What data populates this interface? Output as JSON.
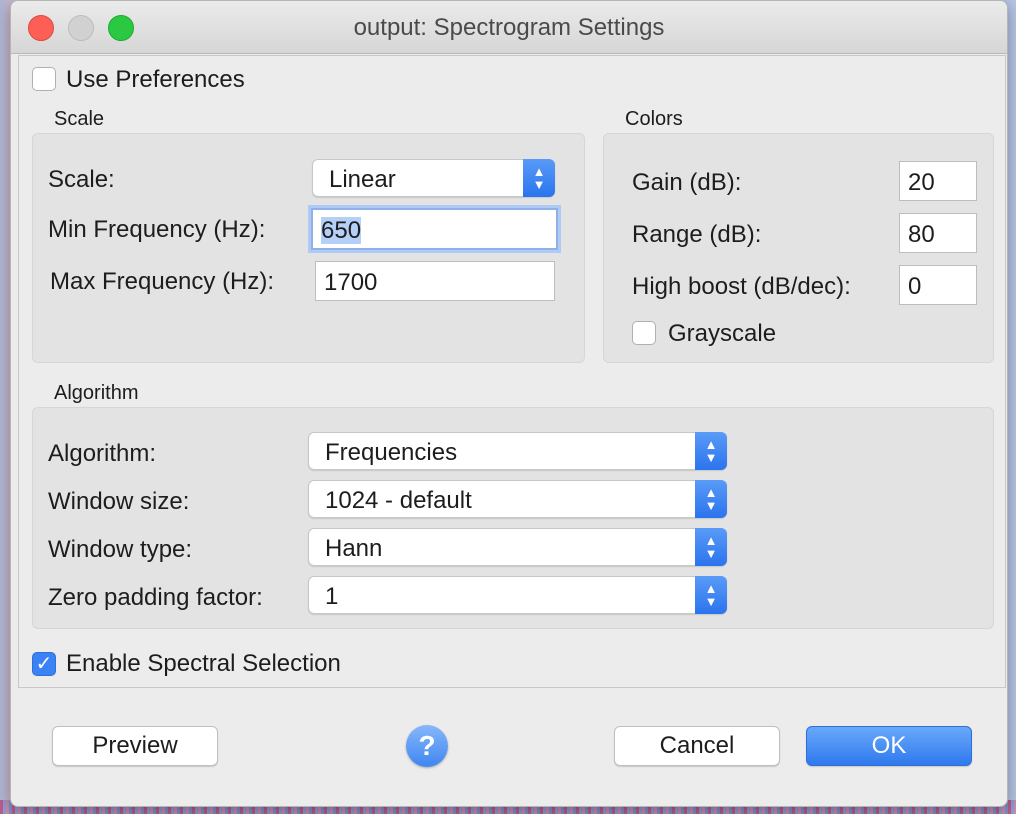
{
  "window": {
    "title": "output: Spectrogram Settings"
  },
  "use_preferences": {
    "label": "Use Preferences",
    "checked": false
  },
  "scale_section": {
    "heading": "Scale",
    "scale_label": "Scale:",
    "scale_value": "Linear",
    "min_freq_label": "Min Frequency (Hz):",
    "min_freq_value": "650",
    "max_freq_label": "Max Frequency (Hz):",
    "max_freq_value": "1700"
  },
  "colors_section": {
    "heading": "Colors",
    "gain_label": "Gain (dB):",
    "gain_value": "20",
    "range_label": "Range (dB):",
    "range_value": "80",
    "boost_label": "High boost (dB/dec):",
    "boost_value": "0",
    "grayscale_label": "Grayscale",
    "grayscale_checked": false
  },
  "algorithm_section": {
    "heading": "Algorithm",
    "algorithm_label": "Algorithm:",
    "algorithm_value": "Frequencies",
    "window_size_label": "Window size:",
    "window_size_value": "1024 - default",
    "window_type_label": "Window type:",
    "window_type_value": "Hann",
    "zero_padding_label": "Zero padding factor:",
    "zero_padding_value": "1"
  },
  "spectral_selection": {
    "label": "Enable Spectral Selection",
    "checked": true,
    "checkmark": "✓"
  },
  "buttons": {
    "preview": "Preview",
    "help": "?",
    "cancel": "Cancel",
    "ok": "OK"
  },
  "icons": {
    "stepper_up": "▲",
    "stepper_down": "▼"
  },
  "colors": {
    "accent": "#2f79ee",
    "close": "#fd5f57",
    "minimize": "#d1d1d1",
    "maximize": "#2bc841"
  }
}
